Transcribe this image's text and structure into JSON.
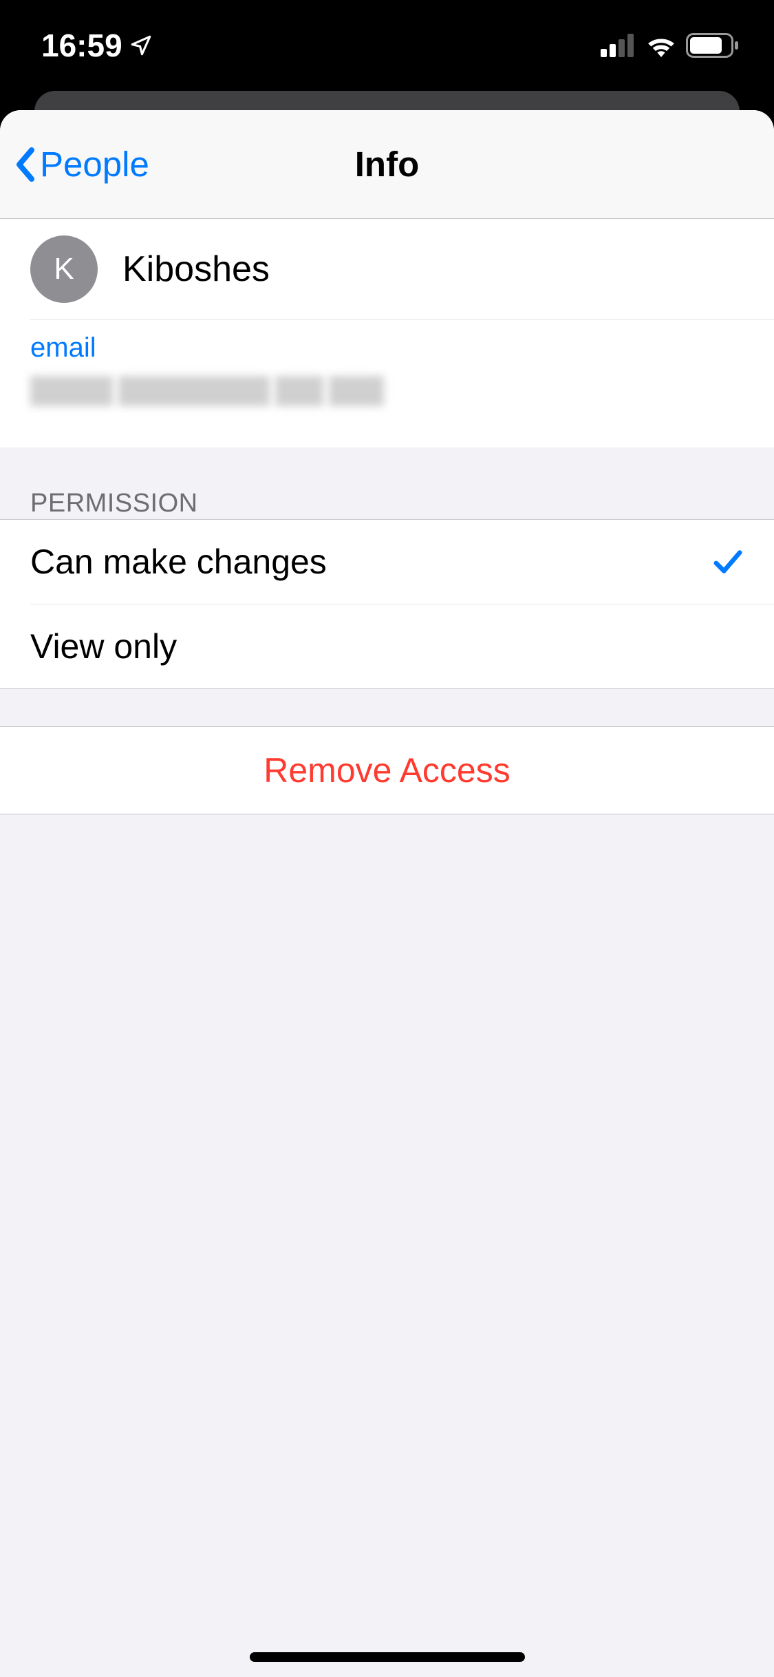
{
  "statusBar": {
    "time": "16:59"
  },
  "nav": {
    "back_label": "People",
    "title": "Info"
  },
  "contact": {
    "initial": "K",
    "name": "Kiboshes",
    "email_label": "email"
  },
  "permission": {
    "header": "PERMISSION",
    "can_make_changes": "Can make changes",
    "view_only": "View only",
    "selected": "can_make_changes"
  },
  "actions": {
    "remove_access": "Remove Access"
  },
  "colors": {
    "accent": "#007aff",
    "destructive": "#ff3b30",
    "secondary_bg": "#f2f2f7"
  }
}
